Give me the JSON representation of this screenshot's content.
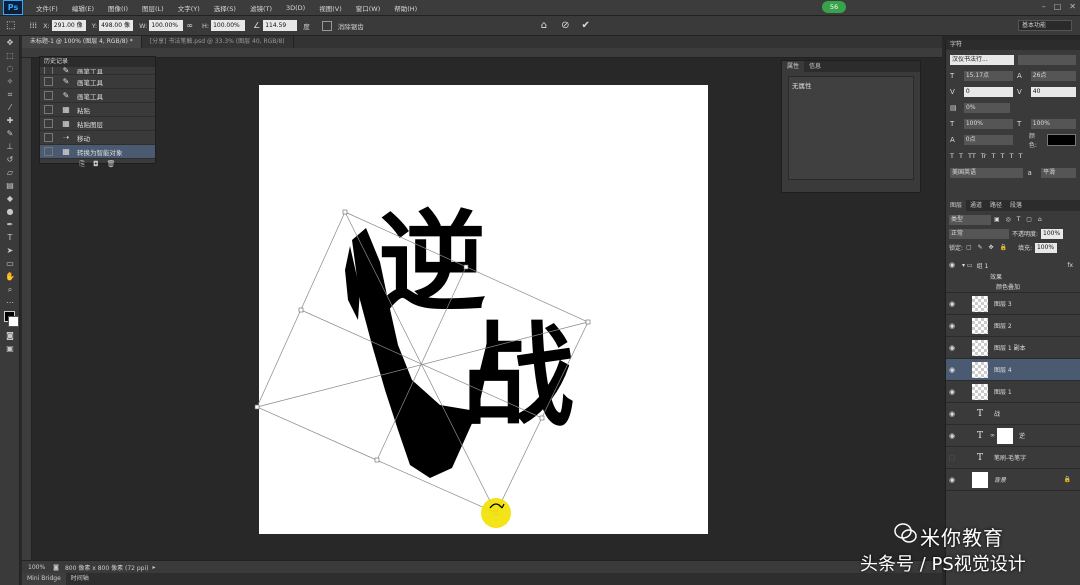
{
  "app": {
    "logo": "Ps",
    "badge": "56"
  },
  "menu": [
    "文件(F)",
    "编辑(E)",
    "图像(I)",
    "图层(L)",
    "文字(Y)",
    "选择(S)",
    "滤镜(T)",
    "3D(D)",
    "视图(V)",
    "窗口(W)",
    "帮助(H)"
  ],
  "options": {
    "x_label": "X:",
    "x_value": "291.00 像",
    "y_label": "Y:",
    "y_value": "498.00 像",
    "w_label": "W:",
    "w_value": "100.00%",
    "h_label": "H:",
    "h_value": "100.00%",
    "angle_value": "114.59",
    "angle_unit": "度",
    "interp_label": "消除锯齿",
    "workspace": "基本功能"
  },
  "tabs": [
    {
      "label": "未标题-1 @ 100% (图层 4, RGB/8) *",
      "active": true
    },
    {
      "label": "[分享] 书法笔触.psd @ 33.3% (图层 40, RGB/8)",
      "active": false
    }
  ],
  "history": {
    "title": "历史记录",
    "items": [
      {
        "label": "画笔工具",
        "icon": "brush-icon"
      },
      {
        "label": "画笔工具",
        "icon": "brush-icon"
      },
      {
        "label": "画笔工具",
        "icon": "brush-icon"
      },
      {
        "label": "粘贴",
        "icon": "layer-icon"
      },
      {
        "label": "粘贴图层",
        "icon": "layer-icon"
      },
      {
        "label": "移动",
        "icon": "move-icon"
      },
      {
        "label": "转换为智能对象",
        "icon": "layer-icon"
      }
    ]
  },
  "properties": {
    "tab1": "属性",
    "tab2": "信息",
    "body": "无属性"
  },
  "character": {
    "title": "字符",
    "font": "汉仪书法行...",
    "size": "15.17点",
    "leading": "26点",
    "kerning": "0",
    "tracking": "40",
    "scale_pct": "0%",
    "vscale": "100%",
    "hscale": "100%",
    "baseline": "0点",
    "color_label": "颜色:",
    "styles": [
      "T",
      "T",
      "TT",
      "Tr",
      "T",
      "T",
      "T",
      "T"
    ],
    "lang": "美国英语",
    "aa": "平滑"
  },
  "layers_panel": {
    "tabs": [
      "图层",
      "通道",
      "路径",
      "段落"
    ],
    "filter": "类型",
    "blend": "正常",
    "opacity_label": "不透明度:",
    "opacity": "100%",
    "lock_label": "锁定:",
    "fill_label": "填充:",
    "fill": "100%",
    "group_name": "组 1",
    "effects_label": "效果",
    "effect_name": "颜色叠加",
    "layers": [
      {
        "name": "图层 3",
        "kind": "smart"
      },
      {
        "name": "图层 2",
        "kind": "smart"
      },
      {
        "name": "图层 1 副本",
        "kind": "smart"
      },
      {
        "name": "图层 4",
        "kind": "smart",
        "selected": true
      },
      {
        "name": "图层 1",
        "kind": "smart"
      },
      {
        "name": "战",
        "kind": "text"
      },
      {
        "name": "逆",
        "kind": "text-mask"
      },
      {
        "name": "笔刷-毛笔字",
        "kind": "text"
      },
      {
        "name": "背景",
        "kind": "bg"
      }
    ]
  },
  "artwork": {
    "char1": "逆",
    "char2": "战"
  },
  "status": {
    "zoom": "100%",
    "doc": "800 像素 x 800 像素 (72 ppi)"
  },
  "bottom_tabs": [
    "Mini Bridge",
    "时间轴"
  ],
  "watermark": {
    "line1": "米你教育",
    "line2": "头条号 / PS视觉设计"
  }
}
